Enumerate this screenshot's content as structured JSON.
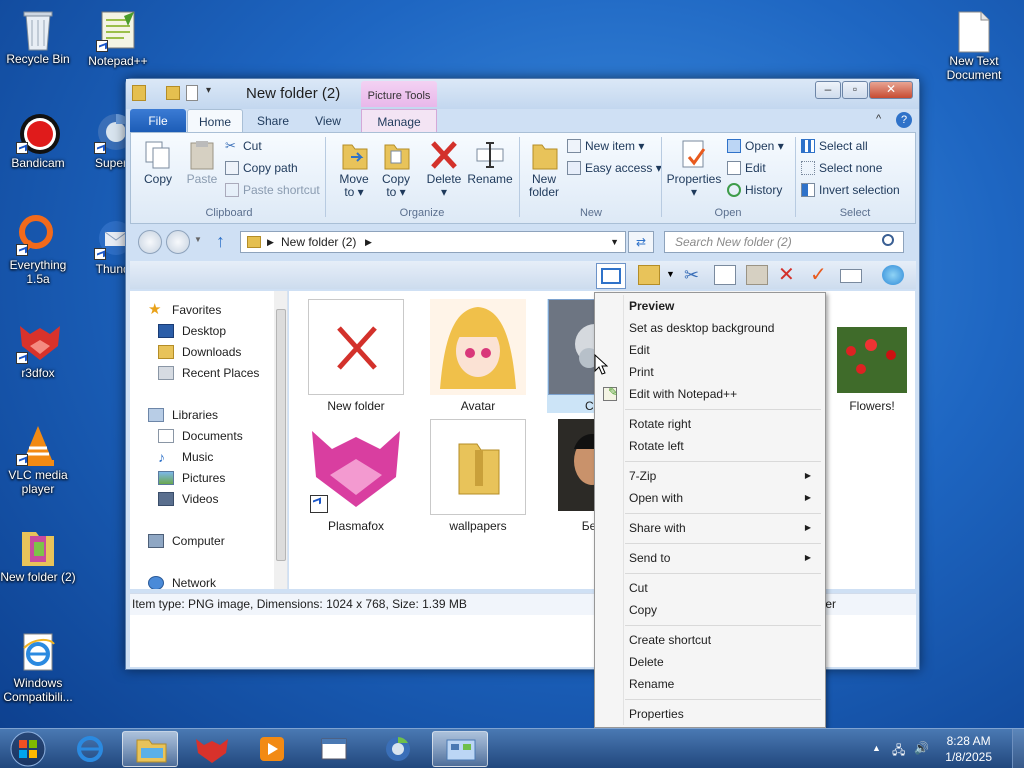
{
  "desktop": {
    "icons": [
      {
        "label": "Recycle Bin"
      },
      {
        "label": "Notepad++"
      },
      {
        "label": "Bandicam"
      },
      {
        "label": "Superm"
      },
      {
        "label": "Everything 1.5a"
      },
      {
        "label": "Thunde"
      },
      {
        "label": "r3dfox"
      },
      {
        "label": "VLC media player"
      },
      {
        "label": "New folder (2)"
      },
      {
        "label": "Windows Compatibili..."
      },
      {
        "label": "New Text Document"
      }
    ]
  },
  "window": {
    "title": "New folder (2)",
    "picture_tools": "Picture Tools",
    "tabs": {
      "file": "File",
      "home": "Home",
      "share": "Share",
      "view": "View",
      "manage": "Manage"
    },
    "ribbon": {
      "clipboard": {
        "copy": "Copy",
        "paste": "Paste",
        "cut": "Cut",
        "copy_path": "Copy path",
        "paste_shortcut": "Paste shortcut",
        "group": "Clipboard"
      },
      "organize": {
        "move_to": "Move",
        "move_to2": "to ▾",
        "copy_to": "Copy",
        "copy_to2": "to ▾",
        "delete": "Delete",
        "delete2": "▾",
        "rename": "Rename",
        "group": "Organize"
      },
      "new": {
        "new_folder": "New",
        "new_folder2": "folder",
        "new_item": "New item ▾",
        "easy_access": "Easy access ▾",
        "group": "New"
      },
      "open": {
        "properties": "Properties",
        "properties2": "▾",
        "open": "Open ▾",
        "edit": "Edit",
        "history": "History",
        "group": "Open"
      },
      "select": {
        "select_all": "Select all",
        "select_none": "Select none",
        "invert": "Invert selection",
        "group": "Select"
      }
    },
    "address": {
      "path": "New folder (2)",
      "search_placeholder": "Search New folder (2)"
    },
    "nav": {
      "favorites": "Favorites",
      "desktop": "Desktop",
      "downloads": "Downloads",
      "recent": "Recent Places",
      "libraries": "Libraries",
      "documents": "Documents",
      "music": "Music",
      "pictures": "Pictures",
      "videos": "Videos",
      "computer": "Computer",
      "network": "Network"
    },
    "files": [
      {
        "name": "New folder"
      },
      {
        "name": "Avatar"
      },
      {
        "name": "Cha"
      },
      {
        "name": "Flowers!"
      },
      {
        "name": "Plasmafox"
      },
      {
        "name": "wallpapers"
      },
      {
        "name": "Безы"
      }
    ],
    "status": "Item type: PNG image, Dimensions: 1024 x 768, Size: 1.39 MB",
    "status_right": "ter"
  },
  "context_menu": {
    "preview": "Preview",
    "set_bg": "Set as desktop background",
    "edit": "Edit",
    "print": "Print",
    "edit_npp": "Edit with Notepad++",
    "rotate_right": "Rotate right",
    "rotate_left": "Rotate left",
    "zip": "7-Zip",
    "open_with": "Open with",
    "share_with": "Share with",
    "send_to": "Send to",
    "cut": "Cut",
    "copy": "Copy",
    "create_shortcut": "Create shortcut",
    "delete": "Delete",
    "rename": "Rename",
    "properties": "Properties"
  },
  "taskbar": {
    "time": "8:28 AM",
    "date": "1/8/2025"
  },
  "colors": {
    "accent": "#1b5bb5",
    "selection": "#cce4f7",
    "close": "#c74b32"
  }
}
